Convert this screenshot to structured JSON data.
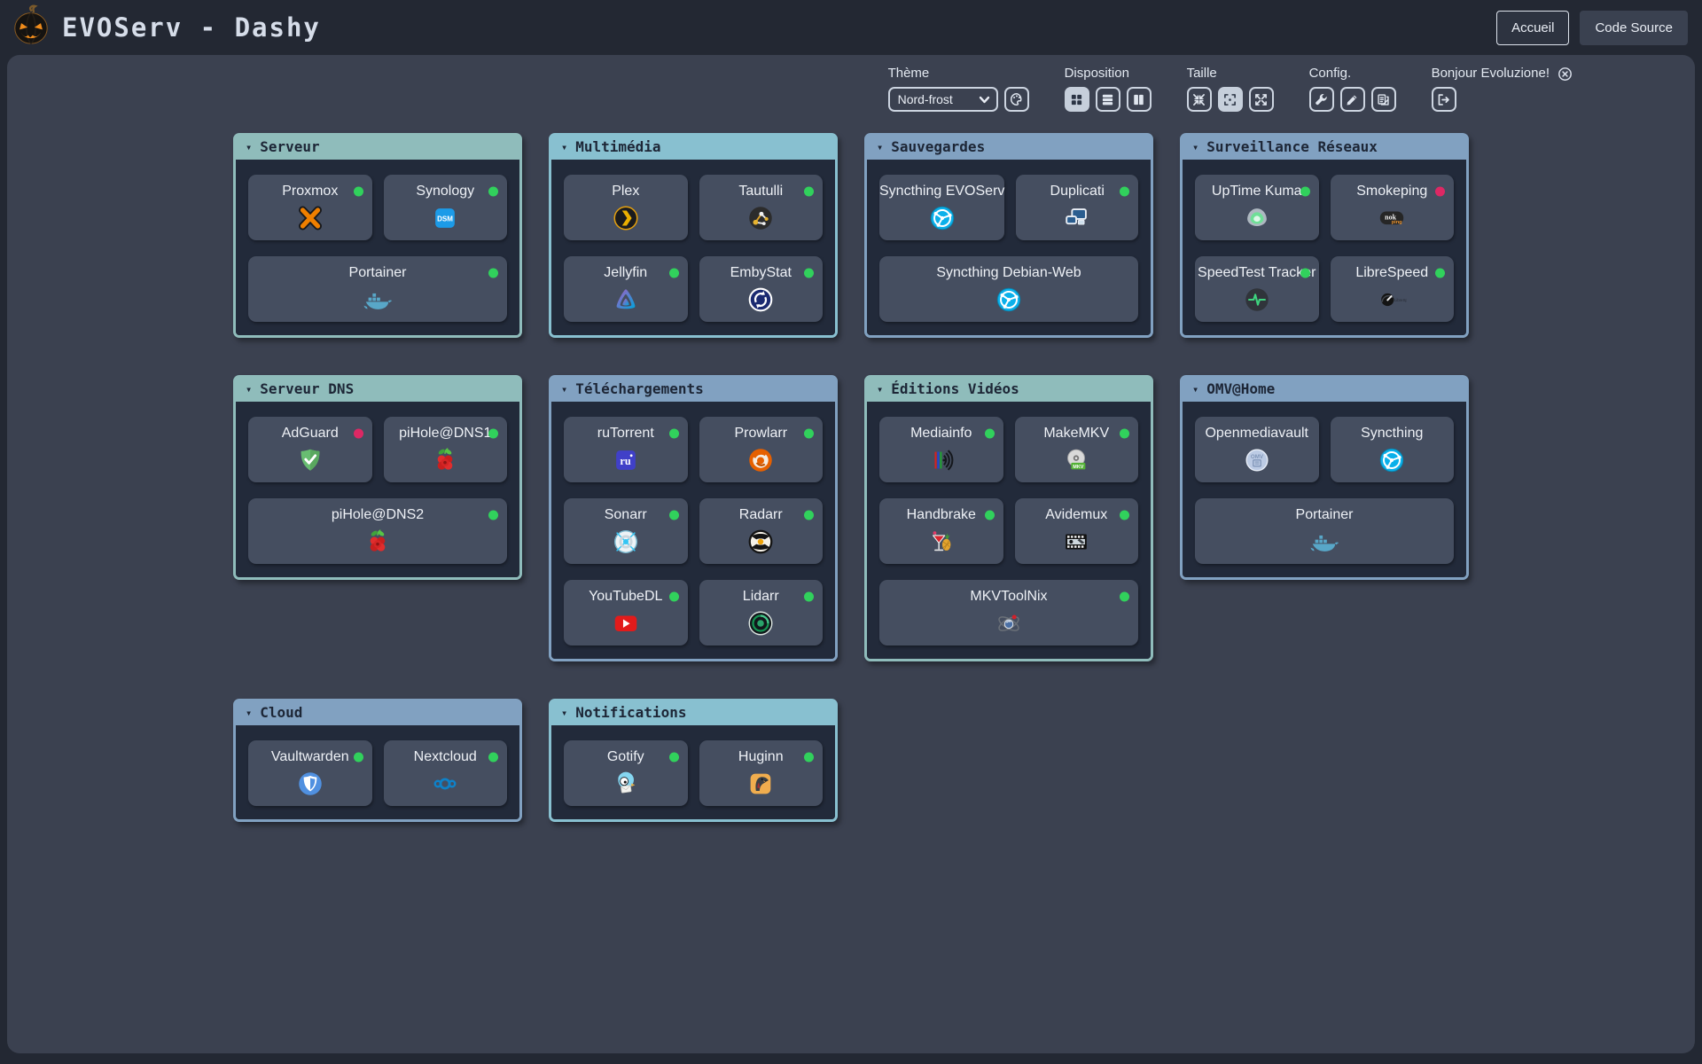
{
  "header": {
    "title": "EVOServ - Dashy",
    "buttons": [
      {
        "label": "Accueil"
      },
      {
        "label": "Code Source"
      }
    ]
  },
  "toolbar": {
    "theme": {
      "label": "Thème",
      "value": "Nord-frost",
      "palette_icon": "palette"
    },
    "disposition": {
      "label": "Disposition",
      "buttons": [
        {
          "icon": "layout-auto",
          "active": true
        },
        {
          "icon": "layout-rows",
          "active": false
        },
        {
          "icon": "layout-columns",
          "active": false
        }
      ]
    },
    "taille": {
      "label": "Taille",
      "buttons": [
        {
          "icon": "size-small",
          "active": false
        },
        {
          "icon": "size-medium",
          "active": true
        },
        {
          "icon": "size-large",
          "active": false
        }
      ]
    },
    "config": {
      "label": "Config.",
      "buttons": [
        {
          "icon": "wrench",
          "active": false
        },
        {
          "icon": "pencil",
          "active": false
        },
        {
          "icon": "swatches",
          "active": false
        }
      ]
    },
    "user": {
      "greeting": "Bonjour Evoluzione!",
      "status_icon": "circle-x",
      "buttons": [
        {
          "icon": "logout",
          "active": false
        }
      ]
    }
  },
  "colors": {
    "status_online": "#31d15c",
    "status_offline": "#dd2864",
    "header_teal": "#8fbcbb",
    "header_cyan": "#88c0d0",
    "header_blue": "#81a1c1"
  },
  "sections": [
    {
      "id": "serveur",
      "title": "Serveur",
      "color": "#8fbcbb",
      "items": [
        {
          "label": "Proxmox",
          "icon": "proxmox",
          "status": "online"
        },
        {
          "label": "Synology",
          "icon": "synology",
          "status": "online"
        },
        {
          "label": "Portainer",
          "icon": "docker",
          "status": "online",
          "wide": true
        }
      ]
    },
    {
      "id": "multimedia",
      "title": "Multimédia",
      "color": "#88c0d0",
      "items": [
        {
          "label": "Plex",
          "icon": "plex",
          "status": null
        },
        {
          "label": "Tautulli",
          "icon": "tautulli",
          "status": "online"
        },
        {
          "label": "Jellyfin",
          "icon": "jellyfin",
          "status": "online"
        },
        {
          "label": "EmbyStat",
          "icon": "embystat",
          "status": "online"
        }
      ]
    },
    {
      "id": "sauvegardes",
      "title": "Sauvegardes",
      "color": "#81a1c1",
      "items": [
        {
          "label": "Syncthing EVOServ",
          "icon": "syncthing",
          "status": null
        },
        {
          "label": "Duplicati",
          "icon": "duplicati",
          "status": "online"
        },
        {
          "label": "Syncthing Debian-Web",
          "icon": "syncthing",
          "status": null,
          "wide": true
        }
      ]
    },
    {
      "id": "surveillance-reseaux",
      "title": "Surveillance Réseaux",
      "color": "#81a1c1",
      "items": [
        {
          "label": "UpTime Kuma",
          "icon": "uptime-kuma",
          "status": "online"
        },
        {
          "label": "Smokeping",
          "icon": "smokeping",
          "status": "offline"
        },
        {
          "label": "SpeedTest Tracker",
          "icon": "speedtest-tracker",
          "status": "online"
        },
        {
          "label": "LibreSpeed",
          "icon": "librespeed",
          "status": "online"
        }
      ]
    },
    {
      "id": "serveur-dns",
      "title": "Serveur DNS",
      "color": "#8fbcbb",
      "items": [
        {
          "label": "AdGuard",
          "icon": "adguard",
          "status": "offline"
        },
        {
          "label": "piHole@DNS1",
          "icon": "pihole",
          "status": "online"
        },
        {
          "label": "piHole@DNS2",
          "icon": "pihole",
          "status": "online",
          "wide": true
        }
      ]
    },
    {
      "id": "telechargements",
      "title": "Téléchargements",
      "color": "#81a1c1",
      "items": [
        {
          "label": "ruTorrent",
          "icon": "rutorrent",
          "status": "online"
        },
        {
          "label": "Prowlarr",
          "icon": "prowlarr",
          "status": "online"
        },
        {
          "label": "Sonarr",
          "icon": "sonarr",
          "status": "online"
        },
        {
          "label": "Radarr",
          "icon": "radarr",
          "status": "online"
        },
        {
          "label": "YouTubeDL",
          "icon": "youtubedl",
          "status": "online"
        },
        {
          "label": "Lidarr",
          "icon": "lidarr",
          "status": "online"
        }
      ]
    },
    {
      "id": "editions-videos",
      "title": "Éditions Vidéos",
      "color": "#8fbcbb",
      "items": [
        {
          "label": "Mediainfo",
          "icon": "mediainfo",
          "status": "online"
        },
        {
          "label": "MakeMKV",
          "icon": "makemkv",
          "status": "online"
        },
        {
          "label": "Handbrake",
          "icon": "handbrake",
          "status": "online"
        },
        {
          "label": "Avidemux",
          "icon": "avidemux",
          "status": "online"
        },
        {
          "label": "MKVToolNix",
          "icon": "mkvtoolnix",
          "status": "online",
          "wide": true
        }
      ]
    },
    {
      "id": "omv-home",
      "title": "OMV@Home",
      "color": "#81a1c1",
      "items": [
        {
          "label": "Openmediavault",
          "icon": "openmediavault",
          "status": null
        },
        {
          "label": "Syncthing",
          "icon": "syncthing",
          "status": null
        },
        {
          "label": "Portainer",
          "icon": "docker",
          "status": null,
          "wide": true
        }
      ]
    },
    {
      "id": "cloud",
      "title": "Cloud",
      "color": "#81a1c1",
      "items": [
        {
          "label": "Vaultwarden",
          "icon": "vaultwarden",
          "status": "online"
        },
        {
          "label": "Nextcloud",
          "icon": "nextcloud",
          "status": "online"
        }
      ]
    },
    {
      "id": "notifications",
      "title": "Notifications",
      "color": "#88c0d0",
      "items": [
        {
          "label": "Gotify",
          "icon": "gotify",
          "status": "online"
        },
        {
          "label": "Huginn",
          "icon": "huginn",
          "status": "online"
        }
      ]
    }
  ]
}
